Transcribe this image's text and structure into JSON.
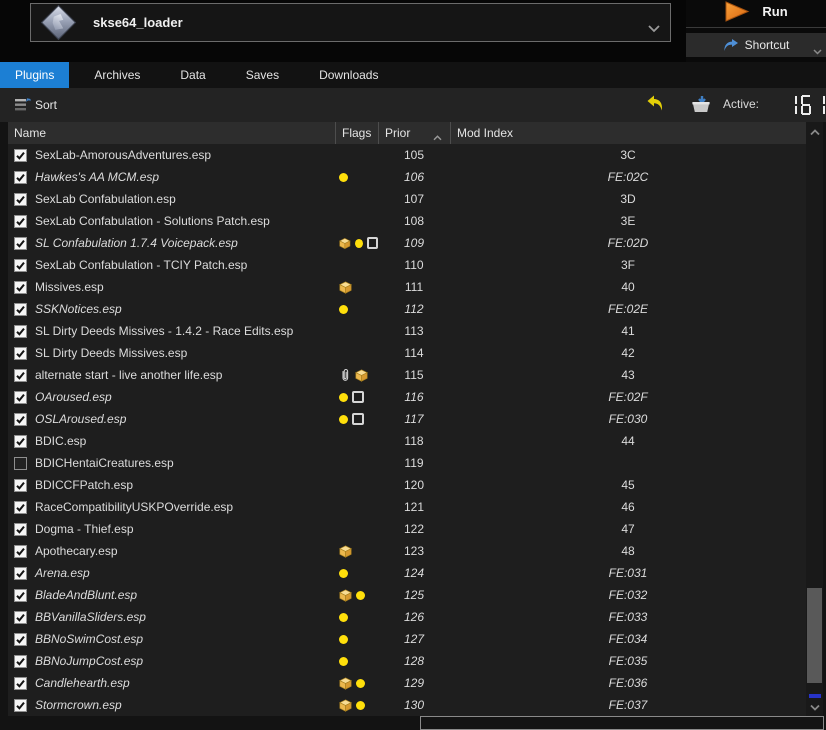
{
  "topbar": {
    "executable_selector": {
      "value": "skse64_loader",
      "icon": "skse-diamond-icon"
    },
    "run_button": {
      "label": "Run",
      "icon_color": "#ef8318"
    },
    "shortcut_button": {
      "label": "Shortcut",
      "icon_color": "#4e8fd6"
    }
  },
  "tabs": [
    {
      "label": "Plugins",
      "active": true
    },
    {
      "label": "Archives",
      "active": false
    },
    {
      "label": "Data",
      "active": false
    },
    {
      "label": "Saves",
      "active": false
    },
    {
      "label": "Downloads",
      "active": false
    }
  ],
  "toolbar": {
    "sort_label": "Sort",
    "active_label": "Active:",
    "active_count": "161"
  },
  "table": {
    "columns": [
      "Name",
      "Flags",
      "Prior",
      "Mod Index"
    ],
    "sort_column": "Prior",
    "sort_direction": "asc",
    "rows": [
      {
        "name": "SexLab-AmorousAdventures.esp",
        "checked": true,
        "flags": [],
        "priority": "105",
        "mod_index": "3C",
        "light": false
      },
      {
        "name": "Hawkes's AA MCM.esp",
        "checked": true,
        "flags": [
          "dot"
        ],
        "priority": "106",
        "mod_index": "FE:02C",
        "light": true
      },
      {
        "name": "SexLab Confabulation.esp",
        "checked": true,
        "flags": [],
        "priority": "107",
        "mod_index": "3D",
        "light": false
      },
      {
        "name": "SexLab Confabulation - Solutions Patch.esp",
        "checked": true,
        "flags": [],
        "priority": "108",
        "mod_index": "3E",
        "light": false
      },
      {
        "name": "SL Confabulation 1.7.4 Voicepack.esp",
        "checked": true,
        "flags": [
          "cube",
          "dot",
          "square"
        ],
        "priority": "109",
        "mod_index": "FE:02D",
        "light": true
      },
      {
        "name": "SexLab Confabulation - TCIY Patch.esp",
        "checked": true,
        "flags": [],
        "priority": "110",
        "mod_index": "3F",
        "light": false
      },
      {
        "name": "Missives.esp",
        "checked": true,
        "flags": [
          "cube"
        ],
        "priority": "111",
        "mod_index": "40",
        "light": false
      },
      {
        "name": "SSKNotices.esp",
        "checked": true,
        "flags": [
          "dot"
        ],
        "priority": "112",
        "mod_index": "FE:02E",
        "light": true
      },
      {
        "name": "SL Dirty Deeds Missives - 1.4.2 - Race Edits.esp",
        "checked": true,
        "flags": [],
        "priority": "113",
        "mod_index": "41",
        "light": false
      },
      {
        "name": "SL Dirty Deeds Missives.esp",
        "checked": true,
        "flags": [],
        "priority": "114",
        "mod_index": "42",
        "light": false
      },
      {
        "name": "alternate start - live another life.esp",
        "checked": true,
        "flags": [
          "clip",
          "cube"
        ],
        "priority": "115",
        "mod_index": "43",
        "light": false
      },
      {
        "name": "OAroused.esp",
        "checked": true,
        "flags": [
          "dot",
          "square"
        ],
        "priority": "116",
        "mod_index": "FE:02F",
        "light": true
      },
      {
        "name": "OSLAroused.esp",
        "checked": true,
        "flags": [
          "dot",
          "square"
        ],
        "priority": "117",
        "mod_index": "FE:030",
        "light": true
      },
      {
        "name": "BDIC.esp",
        "checked": true,
        "flags": [],
        "priority": "118",
        "mod_index": "44",
        "light": false
      },
      {
        "name": "BDICHentaiCreatures.esp",
        "checked": false,
        "flags": [],
        "priority": "119",
        "mod_index": "",
        "light": false
      },
      {
        "name": "BDICCFPatch.esp",
        "checked": true,
        "flags": [],
        "priority": "120",
        "mod_index": "45",
        "light": false
      },
      {
        "name": "RaceCompatibilityUSKPOverride.esp",
        "checked": true,
        "flags": [],
        "priority": "121",
        "mod_index": "46",
        "light": false
      },
      {
        "name": "Dogma - Thief.esp",
        "checked": true,
        "flags": [],
        "priority": "122",
        "mod_index": "47",
        "light": false
      },
      {
        "name": "Apothecary.esp",
        "checked": true,
        "flags": [
          "cube"
        ],
        "priority": "123",
        "mod_index": "48",
        "light": false
      },
      {
        "name": "Arena.esp",
        "checked": true,
        "flags": [
          "dot"
        ],
        "priority": "124",
        "mod_index": "FE:031",
        "light": true
      },
      {
        "name": "BladeAndBlunt.esp",
        "checked": true,
        "flags": [
          "cube",
          "dot"
        ],
        "priority": "125",
        "mod_index": "FE:032",
        "light": true
      },
      {
        "name": "BBVanillaSliders.esp",
        "checked": true,
        "flags": [
          "dot"
        ],
        "priority": "126",
        "mod_index": "FE:033",
        "light": true
      },
      {
        "name": "BBNoSwimCost.esp",
        "checked": true,
        "flags": [
          "dot"
        ],
        "priority": "127",
        "mod_index": "FE:034",
        "light": true
      },
      {
        "name": "BBNoJumpCost.esp",
        "checked": true,
        "flags": [
          "dot"
        ],
        "priority": "128",
        "mod_index": "FE:035",
        "light": true
      },
      {
        "name": "Candlehearth.esp",
        "checked": true,
        "flags": [
          "cube",
          "dot"
        ],
        "priority": "129",
        "mod_index": "FE:036",
        "light": true
      },
      {
        "name": "Stormcrown.esp",
        "checked": true,
        "flags": [
          "cube",
          "dot"
        ],
        "priority": "130",
        "mod_index": "FE:037",
        "light": true
      }
    ]
  },
  "colors": {
    "active_tab": "#1c7fd4",
    "flag_dot": "#ffdf0b",
    "run_orange": "#ef8318",
    "undo_yellow": "#e3cf08",
    "shortcut_blue": "#4e8fd6",
    "scroll_mark_blue": "#2733c8"
  }
}
